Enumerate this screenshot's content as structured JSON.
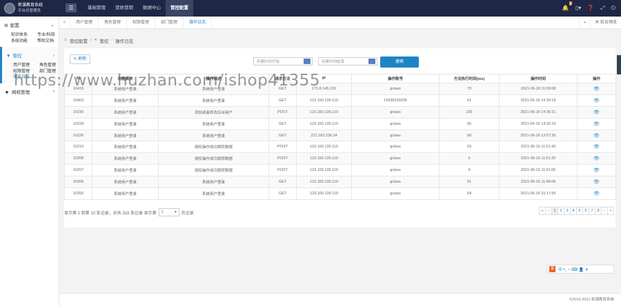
{
  "app": {
    "name": "新课教育系统",
    "subtitle": "平台总管理员"
  },
  "topnav": [
    "基础管理",
    "营收营销",
    "数据中心",
    "管控配置"
  ],
  "topnav_active": 3,
  "top_badge": "1",
  "sidebar": {
    "config": {
      "label": "配置",
      "items": [
        "知识体系",
        "专业/科目",
        "系统功能",
        "帮助文档"
      ]
    },
    "control": {
      "label": "管控",
      "items": [
        "用户管理",
        "角色管理",
        "权限管理",
        "部门管理",
        "操作日志"
      ]
    },
    "network": {
      "label": "网校管理"
    }
  },
  "tabs": [
    "用户管理",
    "角色管理",
    "权限管理",
    "部门管理",
    "操作日志"
  ],
  "tabs_active": 4,
  "tabs_right": "前台预览",
  "breadcrumb": [
    "管控配置",
    "管控",
    "操作日志"
  ],
  "toolbar": {
    "refresh": "刷新",
    "start_placeholder": "创建时间开始",
    "end_placeholder": "创建时间结束",
    "search": "搜索"
  },
  "table": {
    "headers": [
      "ID",
      "功能模块",
      "操作描述",
      "请求方法",
      "IP",
      "操作账号",
      "方法执行时间(ms)",
      "操作时间",
      "操作"
    ],
    "rows": [
      [
        "10419",
        "系统用户登录",
        "系统用户登录",
        "GET",
        "171.8.145.219",
        "gclass",
        "73",
        "2021-06-18 11:09:08"
      ],
      [
        "10403",
        "系统用户登录",
        "系统用户登录",
        "GET",
        "123.160.135.119",
        "15936229295",
        "61",
        "2021-06-16 14:39:19"
      ],
      [
        "10230",
        "系统用户登录",
        "添加或者修改后台用户",
        "POST",
        "123.160.135.119",
        "gclass",
        "155",
        "2021-06-16 14:36:21"
      ],
      [
        "10228",
        "系统用户登录",
        "系统用户登录",
        "GET",
        "123.160.135.119",
        "gclass",
        "56",
        "2021-06-16 14:32:10"
      ],
      [
        "10226",
        "系统用户登录",
        "系统用户登录",
        "GET",
        "221.182.236.34",
        "gclass",
        "68",
        "2021-06-16 13:57:36"
      ],
      [
        "10210",
        "系统用户登录",
        "授权操作成功跳转数据",
        "POST",
        "123.160.135.119",
        "gclass",
        "63",
        "2021-06-16 11:51:42"
      ],
      [
        "10208",
        "系统用户登录",
        "授权操作成功跳转数据",
        "POST",
        "123.160.135.119",
        "gclass",
        "6",
        "2021-06-16 11:51:25"
      ],
      [
        "10207",
        "系统用户登录",
        "授权操作成功跳转数据",
        "POST",
        "123.160.135.119",
        "gclass",
        "9",
        "2021-06-16 11:51:05"
      ],
      [
        "10206",
        "系统用户登录",
        "系统用户登录",
        "GET",
        "123.160.135.119",
        "gclass",
        "61",
        "2021-06-16 11:48:06"
      ],
      [
        "10200",
        "系统用户登录",
        "系统用户登录",
        "GET",
        "123.160.135.119",
        "gclass",
        "64",
        "2021-06-16 10:17:55"
      ]
    ]
  },
  "pagination": {
    "info_prefix": "显示第 1 到第 10 条记录，总共 318 条记录 显示第",
    "page_size": "1",
    "info_suffix": "页记录",
    "pages": [
      "«",
      "‹",
      "1",
      "2",
      "3",
      "4",
      "5",
      "6",
      "7",
      "8",
      "›",
      "»"
    ],
    "current": "1"
  },
  "ime_bar": "中 •, ♀ ⌨ 👤 ✦",
  "footer": "©2016-2021 新课教育系统",
  "watermark": "https://www.huzhan.com/ishop41355"
}
